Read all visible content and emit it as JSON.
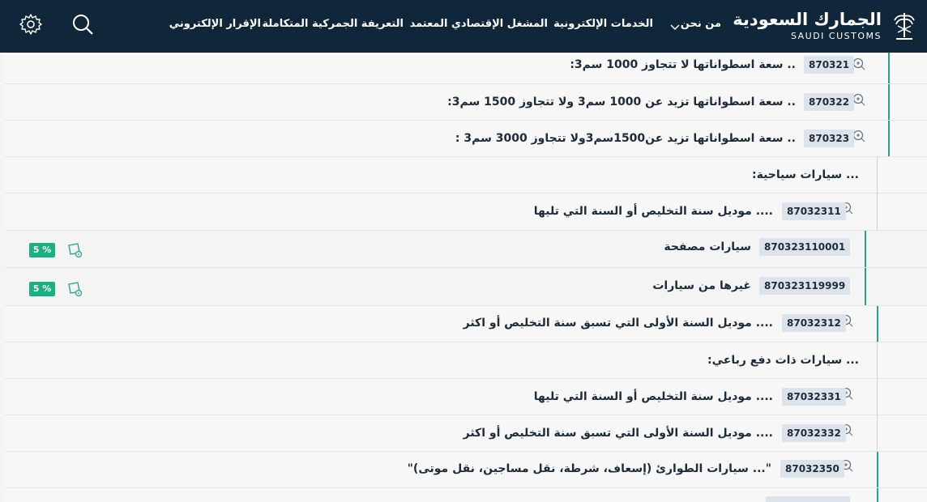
{
  "header": {
    "logo_ar": "الجمارك السعودية",
    "logo_en": "SAUDI CUSTOMS",
    "nav": [
      {
        "label": "من نحن"
      },
      {
        "label": "الخدمات الإلكترونية"
      },
      {
        "label": "المشغل الإقتصادي المعتمد"
      },
      {
        "label": "التعريفة الجمركية المتكاملة"
      },
      {
        "label": "الإقرار الإلكتروني"
      }
    ],
    "icons": {
      "search": "search-icon",
      "settings": "gear-icon",
      "chevron": "chevron-down-icon"
    }
  },
  "colors": {
    "header_bg": "#10263b",
    "accent_green": "#1fa38a",
    "badge_green": "#1bb07f"
  },
  "rows": [
    {
      "code": "870321",
      "desc": ".. سعة اسطواناتها لا تتجاوز 1000 سم3:"
    },
    {
      "code": "870322",
      "desc": ".. سعة اسطواناتها تزيد عن 1000 سم3 ولا تتجاوز 1500 سم3:"
    },
    {
      "code": "870323",
      "desc": ".. سعة اسطواناتها تزيد عن1500سم3ولا تتجاوز 3000 سم3 :"
    },
    {
      "code": "",
      "desc": "... سيارات سياحية:"
    },
    {
      "code": "87032311",
      "desc": ".... موديل سنة التخليص أو السنة التي تليها"
    },
    {
      "code": "870323110001",
      "desc": "سيارات مصفحة",
      "duty": "5 %"
    },
    {
      "code": "870323119999",
      "desc": "غيرها من سيارات",
      "duty": "5 %"
    },
    {
      "code": "87032312",
      "desc": ".... موديل السنة الأولى التي تسبق سنة التخليص أو اكثر"
    },
    {
      "code": "",
      "desc": "... سيارات ذات دفع رباعي:"
    },
    {
      "code": "87032331",
      "desc": ".... موديل سنة التخليص أو السنة التي تليها"
    },
    {
      "code": "87032332",
      "desc": ".... موديل السنة الأولى التي تسبق سنة التخليص أو اكثر"
    },
    {
      "code": "87032350",
      "desc": "\"... سيارات الطوارئ (إسعاف، شرطة، نقل مساجين، نقل موتى)\""
    }
  ]
}
